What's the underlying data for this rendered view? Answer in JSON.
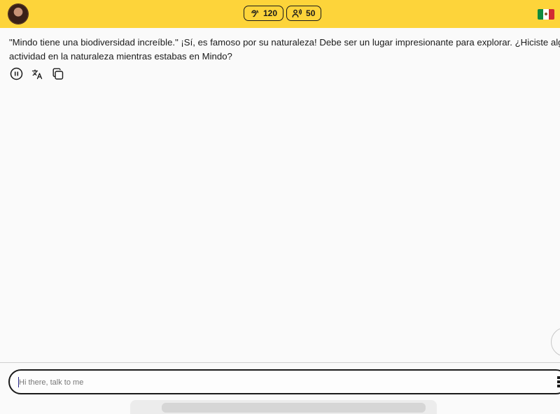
{
  "header": {
    "listen_count": "120",
    "speak_count": "50",
    "avatar_icon": "user-avatar",
    "flag_icon": "mexico-flag",
    "accent_color": "#fdd43a"
  },
  "message": {
    "line1": "\"Mindo tiene una biodiversidad increíble.\" ¡Sí, es famoso por su naturaleza! Debe ser un lugar impresionante para explorar. ¿Hiciste alguna",
    "line2": "actividad en la naturaleza mientras estabas en Mindo?"
  },
  "composer": {
    "placeholder": "Hi there, talk to me",
    "value": ""
  }
}
